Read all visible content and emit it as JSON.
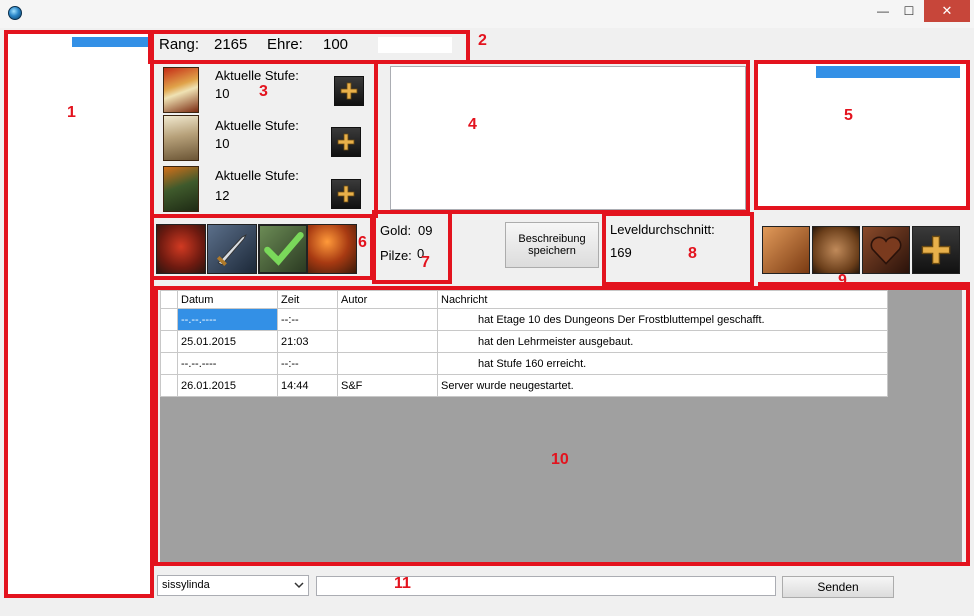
{
  "window": {
    "minimize_symbol": "—",
    "maximize_symbol": "☐",
    "close_symbol": "✕",
    "accent_close": "#c7463a"
  },
  "annotations": {
    "frame_color": "#e3131e",
    "numbers": [
      "1",
      "2",
      "3",
      "4",
      "5",
      "6",
      "7",
      "8",
      "9",
      "10",
      "11"
    ]
  },
  "header": {
    "rang_label": "Rang:",
    "rang_value": "2165",
    "ehre_label": "Ehre:",
    "ehre_value": "100"
  },
  "stufen": [
    {
      "label": "Aktuelle Stufe:",
      "value": "10",
      "icon": "red-warrior-portrait-icon"
    },
    {
      "label": "Aktuelle Stufe:",
      "value": "10",
      "icon": "bald-monster-portrait-icon"
    },
    {
      "label": "Aktuelle Stufe:",
      "value": "12",
      "icon": "fire-warrior-portrait-icon"
    }
  ],
  "resources": {
    "gold_label": "Gold:",
    "gold_value": "09",
    "pilze_label": "Pilze:",
    "pilze_value": "0"
  },
  "save_button": {
    "line1": "Beschreibung",
    "line2": "speichern"
  },
  "level": {
    "label": "Leveldurchschnitt:",
    "value": "169"
  },
  "action_icons": [
    "monster-icon",
    "sword-icon",
    "checkmark-shield-icon",
    "torch-icon"
  ],
  "social_icons": [
    "hand-icon",
    "potato-face-icon",
    "heart-icon",
    "plus-cross-icon"
  ],
  "grid": {
    "columns": [
      "Datum",
      "Zeit",
      "Autor",
      "Nachricht"
    ],
    "rows": [
      {
        "datum": "--.--.----",
        "zeit": "--:--",
        "autor": "",
        "nachricht": "hat Etage 10 des Dungeons Der Frostbluttempel geschafft."
      },
      {
        "datum": "25.01.2015",
        "zeit": "21:03",
        "autor": "",
        "nachricht": "hat den Lehrmeister ausgebaut."
      },
      {
        "datum": "--.--.----",
        "zeit": "--:--",
        "autor": "",
        "nachricht": "hat Stufe 160 erreicht."
      },
      {
        "datum": "26.01.2015",
        "zeit": "14:44",
        "autor": "S&F",
        "nachricht": "Server wurde neugestartet."
      }
    ]
  },
  "footer": {
    "user_select_value": "sissylinda",
    "message_input_value": "",
    "send_label": "Senden"
  }
}
